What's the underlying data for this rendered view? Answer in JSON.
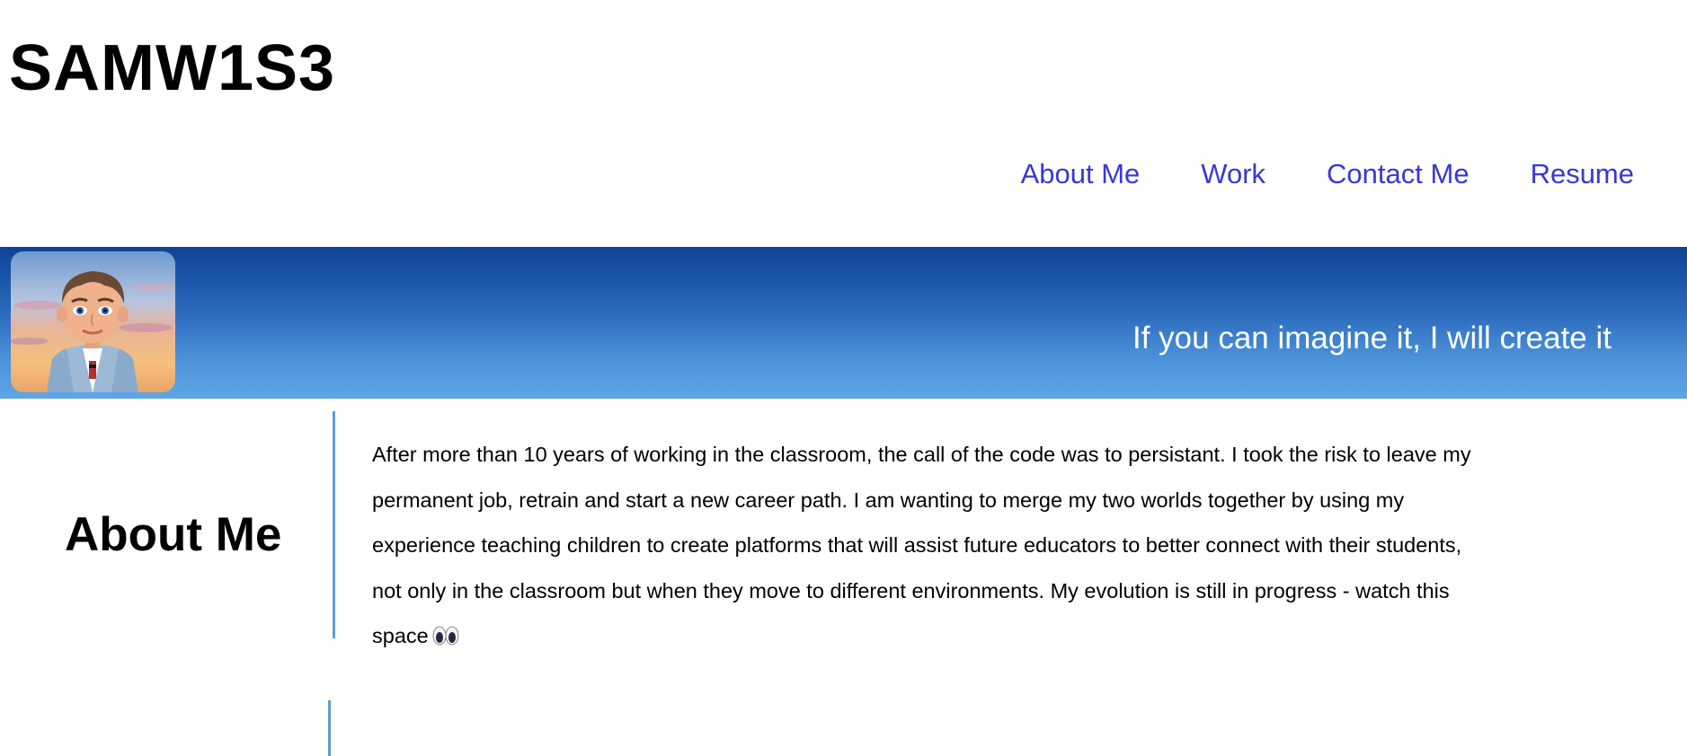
{
  "header": {
    "logo": "SAMW1S3"
  },
  "nav": {
    "items": [
      {
        "label": "About Me"
      },
      {
        "label": "Work"
      },
      {
        "label": "Contact Me"
      },
      {
        "label": "Resume"
      }
    ]
  },
  "hero": {
    "tagline": "If you can imagine it, I will create it",
    "avatar_icon": "bitmoji-avatar-icon"
  },
  "about": {
    "title": "About Me",
    "body": "After more than 10 years of working in the classroom, the call of the code was to persistant. I took the risk to leave my permanent job, retrain and start a new career path. I am wanting to merge my two worlds together by using my experience teaching children to create platforms that will assist future educators to better connect with their students, not only in the classroom but when they move to different environments. My evolution is still in progress - watch this space",
    "emoji_icon": "eyes-emoji-icon"
  },
  "colors": {
    "nav_link": "#3b36d6",
    "hero_top": "#0c4398",
    "hero_bottom": "#5ea6e6",
    "divider": "#5b9fd4"
  }
}
